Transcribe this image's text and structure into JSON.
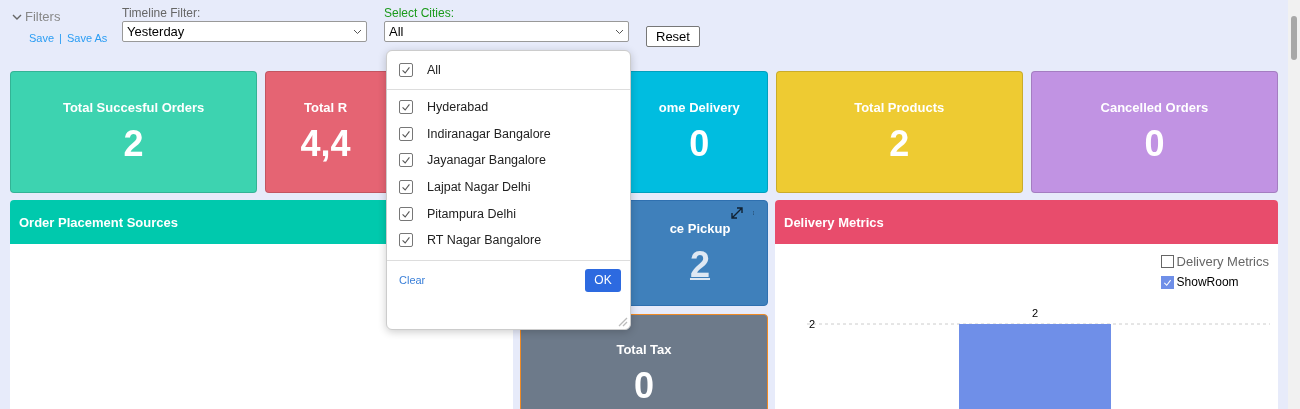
{
  "filters": {
    "toggle_label": "Filters",
    "expanded": true,
    "save_link": "Save",
    "separator": "|",
    "save_as_link": "Save As",
    "timeline": {
      "label": "Timeline Filter:",
      "value": "Yesterday"
    },
    "cities": {
      "label": "Select Cities:",
      "value": "All"
    },
    "reset_button": "Reset"
  },
  "kpi_cards": [
    {
      "title": "Total Succesful Orders",
      "value": "2",
      "color": "#3dd3b0"
    },
    {
      "title": "Total R",
      "value": "4,4",
      "color": "#e56473"
    },
    {
      "title": "ome Delivery",
      "value": "0",
      "color": "#00bde0"
    },
    {
      "title": "Total Products",
      "value": "2",
      "color": "#eecb32"
    },
    {
      "title": "Cancelled Orders",
      "value": "0",
      "color": "#c193e3"
    }
  ],
  "order_sources": {
    "title": "Order Placement Sources"
  },
  "pickup_card": {
    "title": "ce Pickup",
    "value": "2"
  },
  "tax_card": {
    "title": "Total Tax",
    "value": "0"
  },
  "delivery_metrics": {
    "title": "Delivery Metrics",
    "legend": [
      {
        "label": "Delivery Metrics",
        "checked": false
      },
      {
        "label": "ShowRoom",
        "checked": true
      }
    ],
    "y_tick_label": "2",
    "bar_label": "2"
  },
  "city_dropdown": {
    "all": {
      "label": "All",
      "checked": true
    },
    "options": [
      {
        "label": "Hyderabad",
        "checked": true
      },
      {
        "label": "Indiranagar Bangalore",
        "checked": true
      },
      {
        "label": "Jayanagar Bangalore",
        "checked": true
      },
      {
        "label": "Lajpat Nagar Delhi",
        "checked": true
      },
      {
        "label": "Pitampura Delhi",
        "checked": true
      },
      {
        "label": "RT Nagar Bangalore",
        "checked": true
      }
    ],
    "clear_link": "Clear",
    "ok_button": "OK"
  }
}
